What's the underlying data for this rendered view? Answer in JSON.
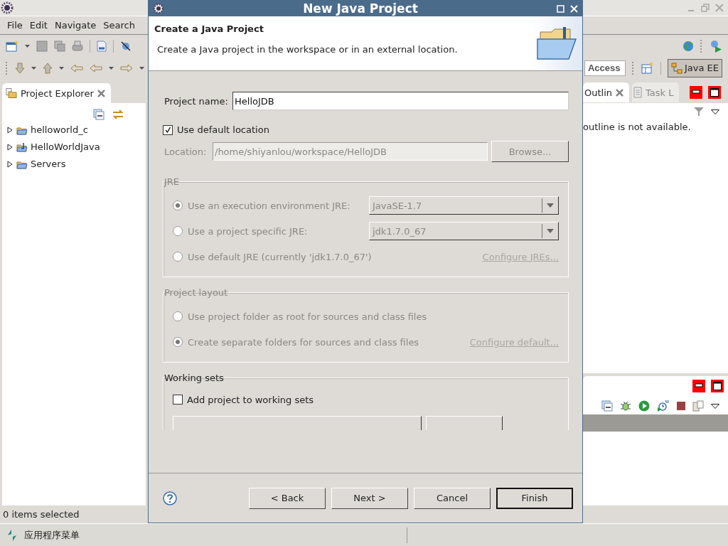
{
  "workbench": {
    "menu": [
      "File",
      "Edit",
      "Navigate",
      "Search"
    ],
    "quick_access": {
      "value": "Access"
    },
    "perspective": {
      "label": "Java EE",
      "selected": true
    },
    "project_explorer": {
      "tab": "Project Explorer",
      "items": [
        {
          "label": "helloworld_c",
          "kind": "folder",
          "expanded": false
        },
        {
          "label": "HelloWorldJava",
          "kind": "java-project",
          "expanded": false
        },
        {
          "label": "Servers",
          "kind": "folder",
          "expanded": false
        }
      ]
    },
    "outline": {
      "tabs": [
        {
          "label": "Outlin",
          "selected": true
        },
        {
          "label": "Task L",
          "selected": false
        }
      ],
      "message": "outline is not available."
    },
    "status": "0 items selected"
  },
  "taskbar": {
    "menu": "应用程序菜单"
  },
  "dialog": {
    "title": "New Java Project",
    "heading": "Create a Java Project",
    "description": "Create a Java project in the workspace or in an external location.",
    "project_name": {
      "label": "Project name:",
      "value": "HelloJDB"
    },
    "default_location": {
      "label": "Use default location",
      "checked": true
    },
    "location": {
      "label": "Location:",
      "value": "/home/shiyanlou/workspace/HelloJDB",
      "disabled": true
    },
    "browse": {
      "label": "Browse...",
      "disabled": true
    },
    "jre": {
      "title": "JRE",
      "disabled": true,
      "options": [
        {
          "label": "Use an execution environment JRE:",
          "selected": true,
          "combo": "JavaSE-1.7"
        },
        {
          "label": "Use a project specific JRE:",
          "selected": false,
          "combo": "jdk1.7.0_67"
        },
        {
          "label": "Use default JRE (currently 'jdk1.7.0_67')",
          "selected": false
        }
      ],
      "link": "Configure JREs..."
    },
    "project_layout": {
      "title": "Project layout",
      "disabled": true,
      "options": [
        {
          "label": "Use project folder as root for sources and class files",
          "selected": false
        },
        {
          "label": "Create separate folders for sources and class files",
          "selected": true
        }
      ],
      "link": "Configure default..."
    },
    "working_sets": {
      "title": "Working sets",
      "add": {
        "label": "Add project to working sets",
        "checked": false
      }
    },
    "buttons": [
      {
        "label": "< Back",
        "default": false
      },
      {
        "label": "Next >",
        "default": false
      },
      {
        "label": "Cancel",
        "default": false
      },
      {
        "label": "Finish",
        "default": true
      }
    ]
  }
}
